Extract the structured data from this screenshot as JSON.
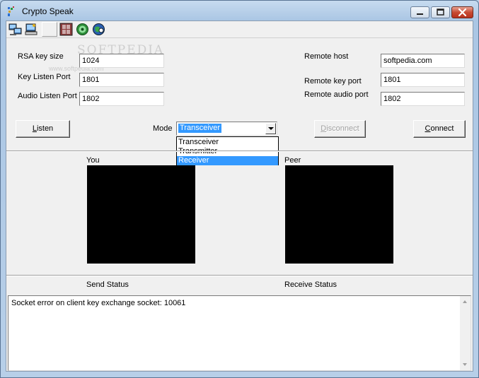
{
  "window": {
    "title": "Crypto Speak",
    "controls": [
      "minimize-icon",
      "maximize-icon",
      "close-icon"
    ]
  },
  "toolbar": {
    "icons": [
      "network-computers-icon",
      "computer-key-icon",
      "blank",
      "film-icon",
      "speaker-icon",
      "globe-icon"
    ]
  },
  "form": {
    "rsa_label": "RSA key size",
    "rsa_value": "1024",
    "key_port_label": "Key Listen Port",
    "key_port_value": "1801",
    "audio_port_label": "Audio Listen Port",
    "audio_port_value": "1802",
    "remote_host_label": "Remote host",
    "remote_host_value": "softpedia.com",
    "remote_key_label": "Remote key port",
    "remote_key_value": "1801",
    "remote_audio_label": "Remote audio port",
    "remote_audio_value": "1802"
  },
  "actions": {
    "listen_ul": "L",
    "listen_rest": "isten",
    "mode_label": "Mode",
    "mode_value": "Transceiver",
    "mode_options": [
      "Transceiver",
      "Transmitter",
      "Receiver"
    ],
    "mode_highlighted": "Receiver",
    "disconnect_ul": "D",
    "disconnect_rest": "isconnect",
    "connect_ul": "C",
    "connect_rest": "onnect"
  },
  "video": {
    "you_label": "You",
    "peer_label": "Peer"
  },
  "status": {
    "send_label": "Send Status",
    "receive_label": "Receive Status"
  },
  "log": {
    "text": "Socket error on client key exchange socket: 10061"
  },
  "watermark": {
    "main": "SOFTPEDIA",
    "sub": "www.softpedia.com"
  },
  "colors": {
    "selection": "#3399ff",
    "video_background": "#000000",
    "dialog_face": "#f0f0f0"
  }
}
